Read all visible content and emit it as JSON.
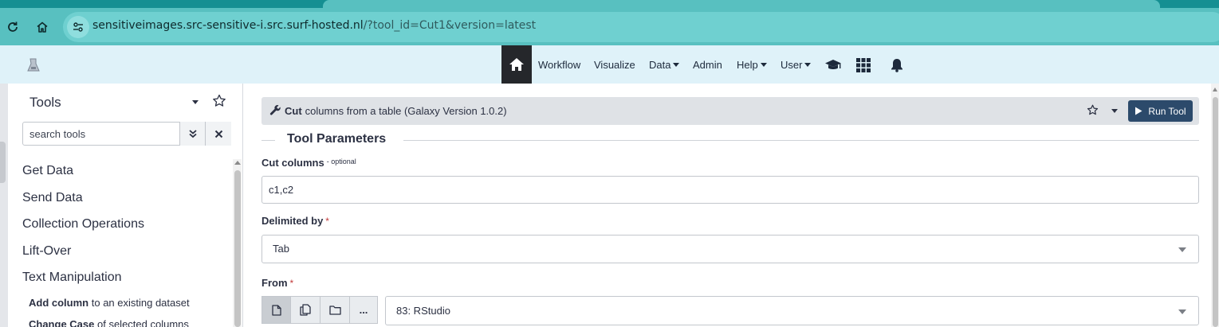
{
  "browser": {
    "url_host": "sensitiveimages.src-sensitive-i.src.surf-hosted.nl",
    "url_path": "/?tool_id=Cut1&version=latest",
    "colors": {
      "bar": "#58c0c0",
      "tab_strip": "#158f92"
    }
  },
  "masthead": {
    "nav": {
      "workflow": "Workflow",
      "visualize": "Visualize",
      "data": "Data",
      "admin": "Admin",
      "help": "Help",
      "user": "User"
    },
    "icons": [
      "home-icon",
      "graduation-cap-icon",
      "apps-grid-icon",
      "bell-icon"
    ],
    "colors": {
      "background": "#dff2f9",
      "home_active": "#25272b"
    }
  },
  "tool_panel": {
    "title": "Tools",
    "search_placeholder": "search tools",
    "sections": [
      "Get Data",
      "Send Data",
      "Collection Operations",
      "Lift-Over",
      "Text Manipulation"
    ],
    "tools": [
      {
        "name": "Add column",
        "description": "to an existing dataset"
      },
      {
        "name": "Change Case",
        "description": "of selected columns"
      }
    ]
  },
  "tool_form": {
    "tool_name": "Cut",
    "tool_description": "columns from a table (Galaxy Version 1.0.2)",
    "run_label": "Run Tool",
    "params_title": "Tool Parameters",
    "fields": {
      "cut_columns": {
        "label": "Cut columns",
        "note": "- optional",
        "value": "c1,c2"
      },
      "delimited_by": {
        "label": "Delimited by",
        "required_mark": "*",
        "value": "Tab"
      },
      "from": {
        "label": "From",
        "required_mark": "*",
        "value": "83: RStudio",
        "more_label": "..."
      }
    },
    "colors": {
      "run_button": "#2c4a6b",
      "header": "#dfe2e6",
      "required": "#c23a3a"
    }
  }
}
